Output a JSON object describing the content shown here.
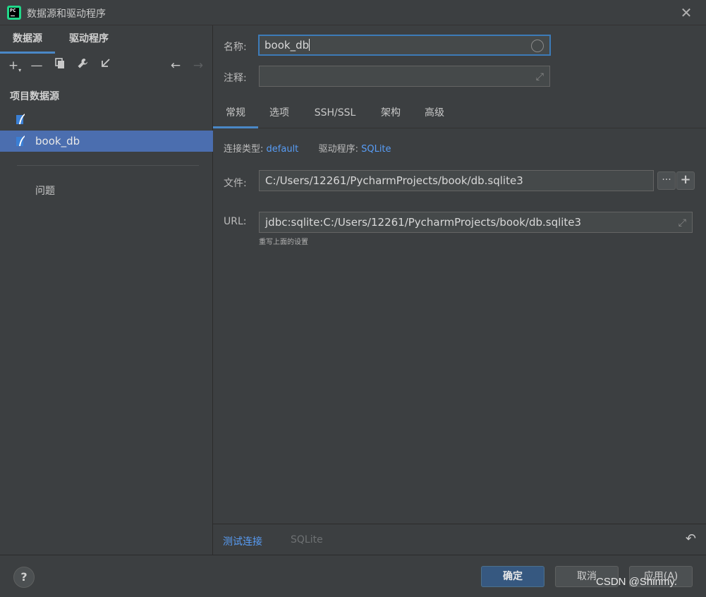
{
  "window": {
    "title": "数据源和驱动程序"
  },
  "left": {
    "tabs": [
      "数据源",
      "驱动程序"
    ],
    "section_title": "项目数据源",
    "datasources": [
      {
        "label": ""
      },
      {
        "label": "book_db"
      }
    ],
    "problems_label": "问题"
  },
  "form": {
    "name_label": "名称:",
    "name_value": "book_db",
    "comment_label": "注释:",
    "comment_value": "",
    "tabs": [
      "常规",
      "选项",
      "SSH/SSL",
      "架构",
      "高级"
    ],
    "connection_type_label": "连接类型:",
    "connection_type_value": "default",
    "driver_label": "驱动程序:",
    "driver_value": "SQLite",
    "file_label": "文件:",
    "file_value": "C:/Users/12261/PycharmProjects/book/db.sqlite3",
    "browse_label": "···",
    "add_label": "+",
    "url_label": "URL:",
    "url_value": "jdbc:sqlite:C:/Users/12261/PycharmProjects/book/db.sqlite3",
    "url_hint": "重写上面的设置"
  },
  "bottom": {
    "test_connection": "测试连接",
    "driver_name": "SQLite"
  },
  "footer": {
    "help": "?",
    "ok": "确定",
    "cancel": "取消",
    "apply": "应用(A)"
  },
  "watermark": "CSDN @Shinmy."
}
